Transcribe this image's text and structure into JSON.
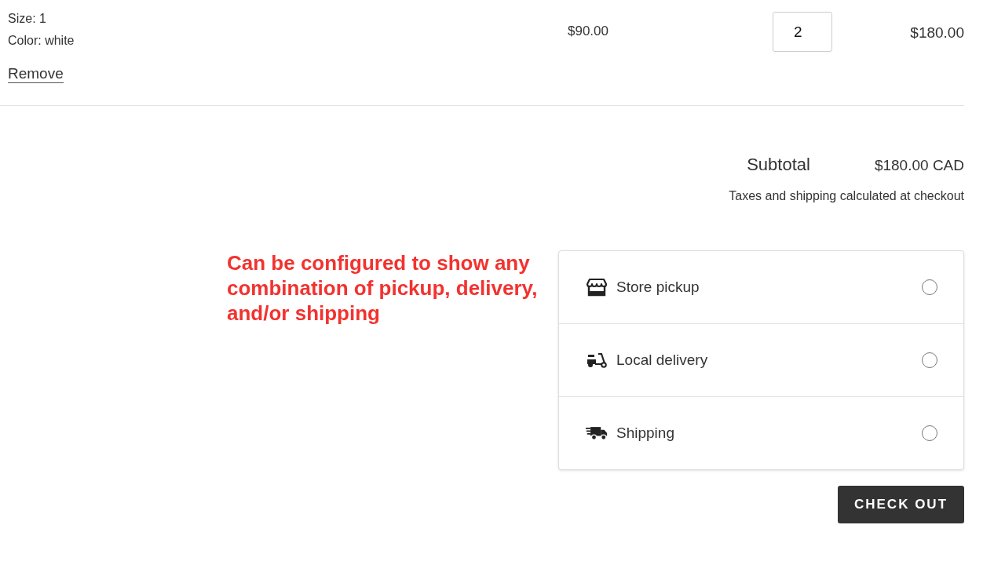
{
  "line_item": {
    "details": [
      "Size: 1",
      "Color: white"
    ],
    "remove_link": "Remove",
    "price": "$90.00",
    "quantity": "2",
    "total": "$180.00"
  },
  "summary": {
    "subtotal_label": "Subtotal",
    "subtotal_value": "$180.00 CAD",
    "note": "Taxes and shipping calculated at checkout"
  },
  "annotation": {
    "text": "Can be configured to show any combination of pickup, delivery, and/or shipping"
  },
  "delivery_options": [
    {
      "kind": "store",
      "label": "Store pickup",
      "selected": false
    },
    {
      "kind": "scooter",
      "label": "Local delivery",
      "selected": false
    },
    {
      "kind": "truck",
      "label": "Shipping",
      "selected": false
    }
  ],
  "checkout_button": "CHECK OUT"
}
